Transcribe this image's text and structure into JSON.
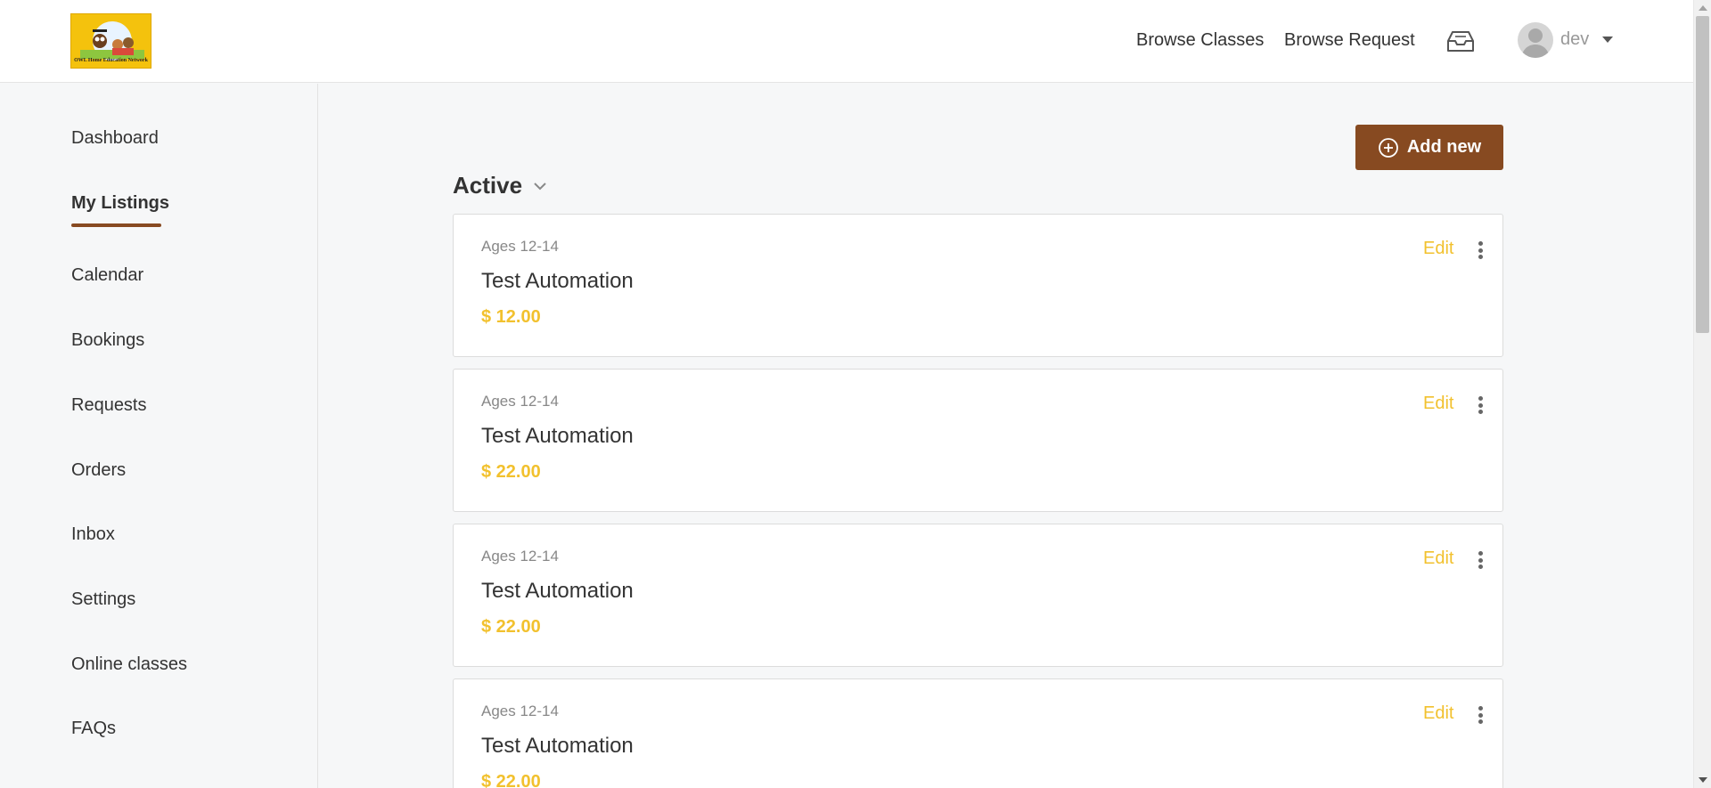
{
  "header": {
    "logo_text": "OWL Home Education Network",
    "nav": {
      "browse_classes": "Browse Classes",
      "browse_request": "Browse Request"
    },
    "user": {
      "name": "dev"
    }
  },
  "sidebar": {
    "items": [
      {
        "label": "Dashboard",
        "active": false
      },
      {
        "label": "My Listings",
        "active": true
      },
      {
        "label": "Calendar",
        "active": false
      },
      {
        "label": "Bookings",
        "active": false
      },
      {
        "label": "Requests",
        "active": false
      },
      {
        "label": "Orders",
        "active": false
      },
      {
        "label": "Inbox",
        "active": false
      },
      {
        "label": "Settings",
        "active": false
      },
      {
        "label": "Online classes",
        "active": false
      },
      {
        "label": "FAQs",
        "active": false
      }
    ]
  },
  "main": {
    "add_button": "Add new",
    "status_filter": "Active",
    "listings": [
      {
        "ages": "Ages 12-14",
        "title": "Test Automation",
        "price": "$ 12.00",
        "edit": "Edit"
      },
      {
        "ages": "Ages 12-14",
        "title": "Test Automation",
        "price": "$ 22.00",
        "edit": "Edit"
      },
      {
        "ages": "Ages 12-14",
        "title": "Test Automation",
        "price": "$ 22.00",
        "edit": "Edit"
      },
      {
        "ages": "Ages 12-14",
        "title": "Test Automation",
        "price": "$ 22.00",
        "edit": "Edit"
      }
    ]
  },
  "colors": {
    "brand": "#874a21",
    "accent_yellow": "#f2c12e",
    "logo_bg": "#f4c20d"
  }
}
